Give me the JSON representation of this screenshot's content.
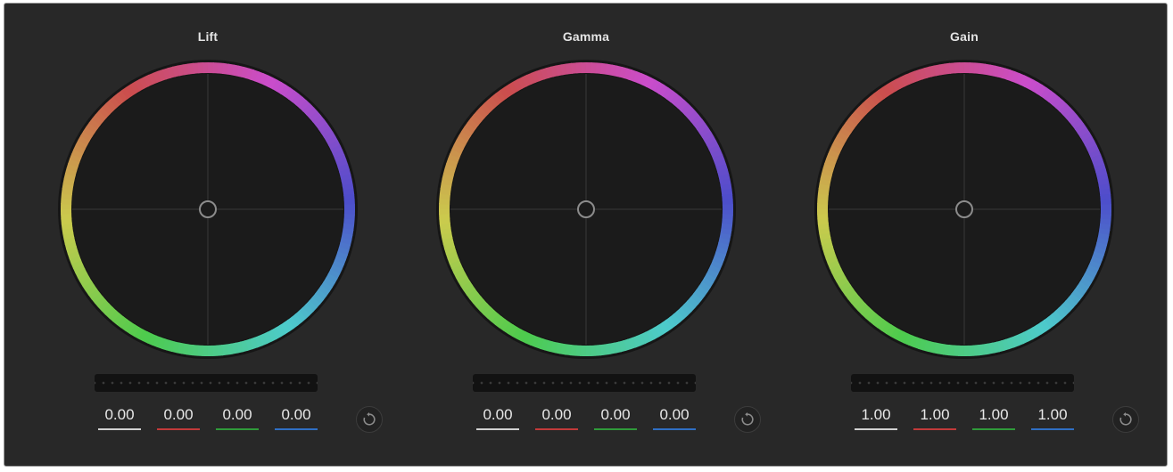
{
  "wheels": [
    {
      "title": "Lift",
      "values": {
        "master": "0.00",
        "red": "0.00",
        "green": "0.00",
        "blue": "0.00"
      },
      "reset_icon": "reset-icon"
    },
    {
      "title": "Gamma",
      "values": {
        "master": "0.00",
        "red": "0.00",
        "green": "0.00",
        "blue": "0.00"
      },
      "reset_icon": "reset-icon"
    },
    {
      "title": "Gain",
      "values": {
        "master": "1.00",
        "red": "1.00",
        "green": "1.00",
        "blue": "1.00"
      },
      "reset_icon": "reset-icon"
    }
  ],
  "colors": {
    "panel_bg": "#282828",
    "master_line": "#d0d0d0",
    "red_line": "#c23a3a",
    "green_line": "#2f9a3a",
    "blue_line": "#2f6fc4"
  }
}
